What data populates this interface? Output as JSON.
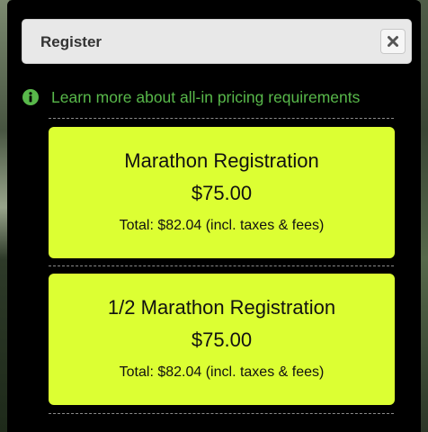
{
  "modal": {
    "title": "Register",
    "close_icon": "close-icon",
    "info": {
      "icon": "info-circle-icon",
      "link_text": "Learn more about all-in pricing requirements"
    },
    "registrations": [
      {
        "name": "Marathon Registration",
        "price": "$75.00",
        "total": "Total: $82.04 (incl. taxes & fees)"
      },
      {
        "name": "1/2 Marathon Registration",
        "price": "$75.00",
        "total": "Total: $82.04 (incl. taxes & fees)"
      }
    ]
  },
  "colors": {
    "card": "#dcff33",
    "link": "#58b84a",
    "modal_bg": "#000000",
    "header_bg": "#e8e8e8"
  }
}
